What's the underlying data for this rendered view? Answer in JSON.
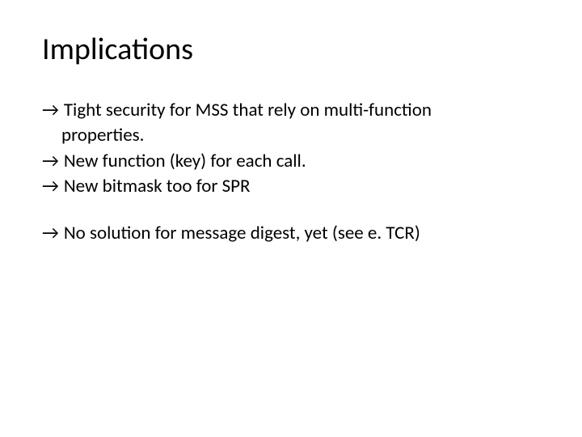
{
  "title": "Implications",
  "arrow": "→",
  "group1": {
    "item1_line1": "Tight security for MSS that rely on multi-function",
    "item1_line2": "properties.",
    "item2": "New function (key) for each call.",
    "item3": "New bitmask too for SPR"
  },
  "group2": {
    "item1": "No solution for message digest, yet (see e. TCR)"
  }
}
